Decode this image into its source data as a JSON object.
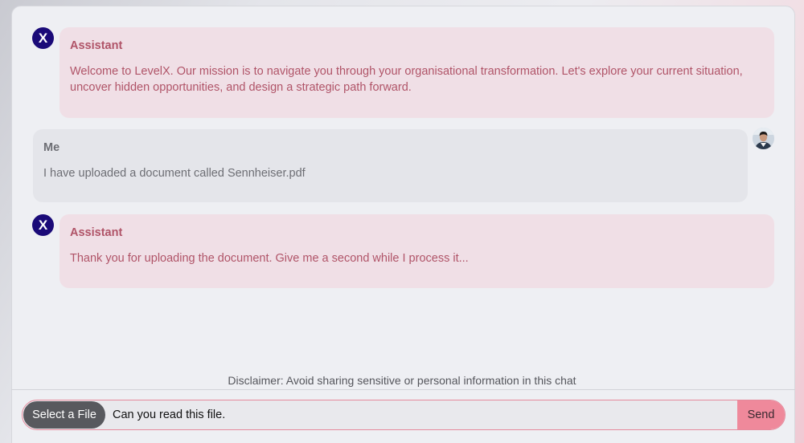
{
  "chat": {
    "messages": [
      {
        "sender": "Assistant",
        "role": "assistant",
        "avatar_text": "X",
        "text": "Welcome to LevelX. Our mission is to navigate you through your organisational transformation. Let's explore your current situation, uncover hidden opportunities, and design a strategic path forward."
      },
      {
        "sender": "Me",
        "role": "user",
        "avatar": "user-avatar-photo",
        "text": "I have uploaded a document called Sennheiser.pdf"
      },
      {
        "sender": "Assistant",
        "role": "assistant",
        "avatar_text": "X",
        "text": "Thank you for uploading the document. Give me a second while I process it..."
      }
    ]
  },
  "disclaimer": "Disclaimer: Avoid sharing sensitive or personal information in this chat",
  "composer": {
    "file_button_label": "Select a File",
    "input_value": "Can you read this file.",
    "send_label": "Send"
  },
  "colors": {
    "assistant_avatar": "#1a0a78",
    "assistant_bubble": "#f0dfe6",
    "assistant_text": "#b05468",
    "user_bubble": "#e4e5ea",
    "send_button": "#ef899b",
    "file_button": "#58595e",
    "input_border": "#e58a9c"
  }
}
